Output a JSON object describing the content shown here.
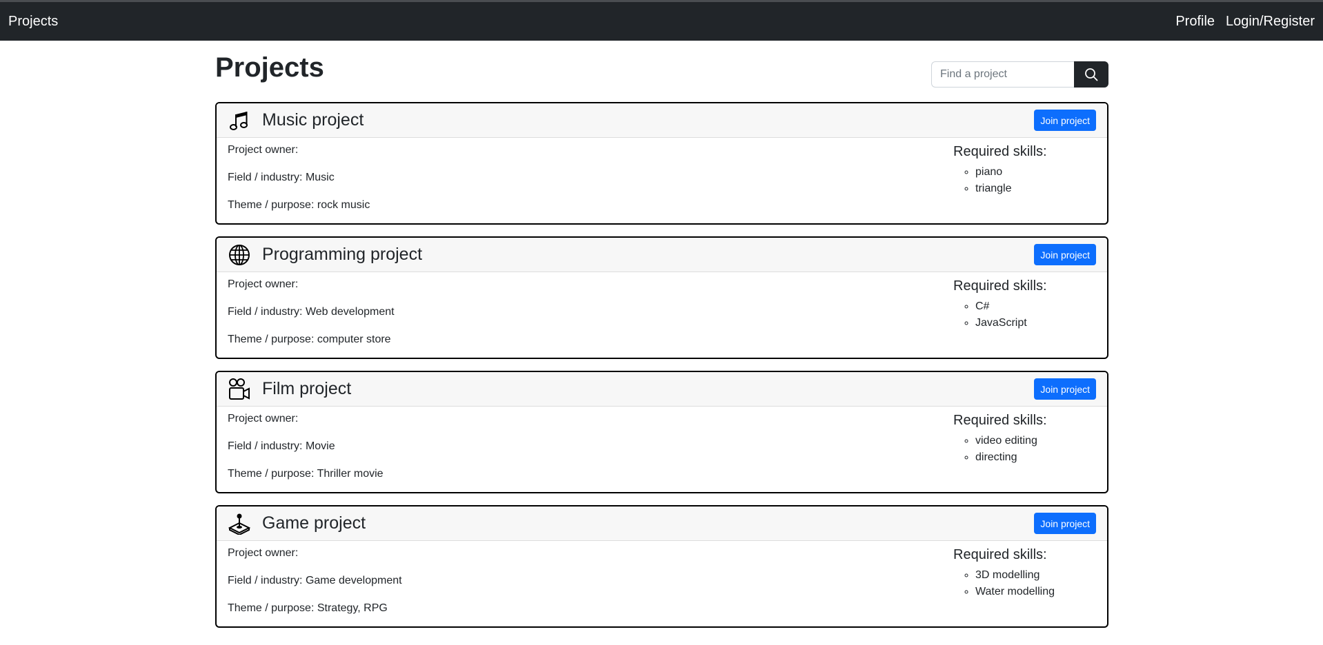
{
  "nav": {
    "brand": "Projects",
    "links": [
      "Profile",
      "Login/Register"
    ]
  },
  "page": {
    "title": "Projects",
    "search_placeholder": "Find a project",
    "search_icon": "search-icon"
  },
  "labels": {
    "owner": "Project owner:",
    "field_prefix": "Field / industry:",
    "theme_prefix": "Theme / purpose:",
    "skills_title": "Required skills:",
    "join": "Join project"
  },
  "projects": [
    {
      "icon": "music-note-icon",
      "title": "Music project",
      "owner": "",
      "field": "Music",
      "theme": "rock music",
      "skills": [
        "piano",
        "triangle"
      ]
    },
    {
      "icon": "globe-icon",
      "title": "Programming project",
      "owner": "",
      "field": "Web development",
      "theme": "computer store",
      "skills": [
        "C#",
        "JavaScript"
      ]
    },
    {
      "icon": "camera-reels-icon",
      "title": "Film project",
      "owner": "",
      "field": "Movie",
      "theme": "Thriller movie",
      "skills": [
        "video editing",
        "directing"
      ]
    },
    {
      "icon": "joystick-icon",
      "title": "Game project",
      "owner": "",
      "field": "Game development",
      "theme": "Strategy, RPG",
      "skills": [
        "3D modelling",
        "Water modelling"
      ]
    }
  ],
  "colors": {
    "navbar": "#212529",
    "primary": "#0d6efd",
    "card_border": "#000000",
    "card_header": "#f7f7f7"
  }
}
